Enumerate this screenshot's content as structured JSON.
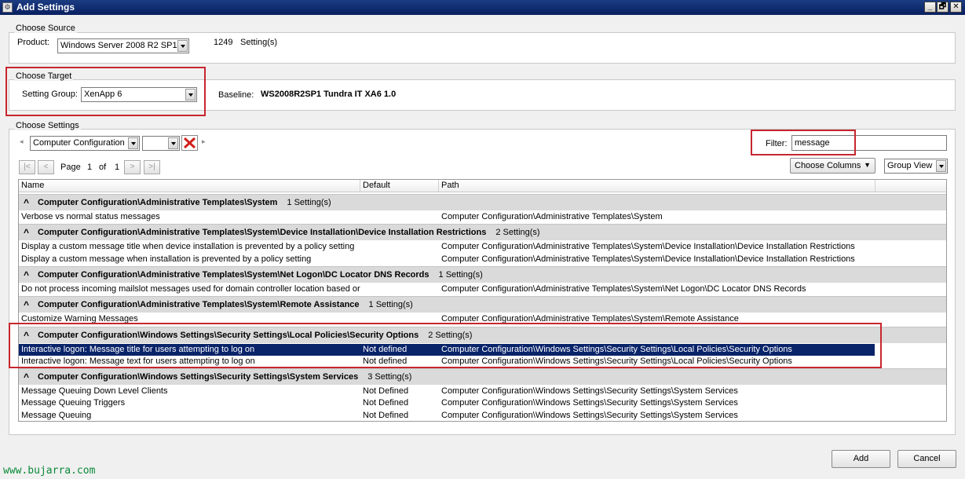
{
  "window": {
    "title": "Add Settings",
    "minimize": "_",
    "restore": "🗗",
    "close": "✕"
  },
  "source": {
    "label": "Choose Source",
    "product_label": "Product:",
    "product_value": "Windows Server 2008 R2 SP1",
    "count": "1249",
    "count_suffix": "Setting(s)"
  },
  "target": {
    "label": "Choose Target",
    "group_label": "Setting Group:",
    "group_value": "XenApp 6",
    "baseline_label": "Baseline:",
    "baseline_value": "WS2008R2SP1 Tundra IT XA6 1.0"
  },
  "settings": {
    "label": "Choose Settings",
    "scope_value": "Computer Configuration",
    "filter_label": "Filter:",
    "filter_value": "message",
    "page_label": "Page",
    "page_current": "1",
    "page_of": "of",
    "page_total": "1",
    "choose_columns": "Choose Columns",
    "group_view": "Group View"
  },
  "grid": {
    "columns": [
      "Name",
      "Default",
      "Path"
    ],
    "groups": [
      {
        "title": "Computer Configuration\\Administrative Templates\\System",
        "count": "1 Setting(s)",
        "rows": [
          {
            "name": "Verbose vs normal status messages",
            "default": "",
            "path": "Computer Configuration\\Administrative Templates\\System"
          }
        ]
      },
      {
        "title": "Computer Configuration\\Administrative Templates\\System\\Device Installation\\Device Installation Restrictions",
        "count": "2 Setting(s)",
        "rows": [
          {
            "name": "Display a custom message title when device installation is prevented by a policy setting",
            "default": "",
            "path": "Computer Configuration\\Administrative Templates\\System\\Device Installation\\Device Installation Restrictions"
          },
          {
            "name": "Display a custom message when installation is prevented by a policy setting",
            "default": "",
            "path": "Computer Configuration\\Administrative Templates\\System\\Device Installation\\Device Installation Restrictions"
          }
        ]
      },
      {
        "title": "Computer Configuration\\Administrative Templates\\System\\Net Logon\\DC Locator DNS Records",
        "count": "1 Setting(s)",
        "rows": [
          {
            "name": "Do not process incoming mailslot messages used for domain controller location based or",
            "default": "",
            "path": "Computer Configuration\\Administrative Templates\\System\\Net Logon\\DC Locator DNS Records"
          }
        ]
      },
      {
        "title": "Computer Configuration\\Administrative Templates\\System\\Remote Assistance",
        "count": "1 Setting(s)",
        "rows": [
          {
            "name": "Customize Warning Messages",
            "default": "",
            "path": "Computer Configuration\\Administrative Templates\\System\\Remote Assistance"
          }
        ]
      },
      {
        "title": "Computer Configuration\\Windows Settings\\Security Settings\\Local Policies\\Security Options",
        "count": "2 Setting(s)",
        "rows": [
          {
            "name": "Interactive logon: Message title for users attempting to log on",
            "default": "Not defined",
            "path": "Computer Configuration\\Windows Settings\\Security Settings\\Local Policies\\Security Options"
          },
          {
            "name": "Interactive logon: Message text for users attempting to log on",
            "default": "Not defined",
            "path": "Computer Configuration\\Windows Settings\\Security Settings\\Local Policies\\Security Options"
          }
        ]
      },
      {
        "title": "Computer Configuration\\Windows Settings\\Security Settings\\System Services",
        "count": "3 Setting(s)",
        "rows": [
          {
            "name": "Message Queuing Down Level Clients",
            "default": "Not Defined",
            "path": "Computer Configuration\\Windows Settings\\Security Settings\\System Services"
          },
          {
            "name": "Message Queuing Triggers",
            "default": "Not Defined",
            "path": "Computer Configuration\\Windows Settings\\Security Settings\\System Services"
          },
          {
            "name": "Message Queuing",
            "default": "Not Defined",
            "path": "Computer Configuration\\Windows Settings\\Security Settings\\System Services"
          }
        ]
      }
    ]
  },
  "buttons": {
    "add": "Add",
    "cancel": "Cancel"
  },
  "watermark": "www.bujarra.com"
}
